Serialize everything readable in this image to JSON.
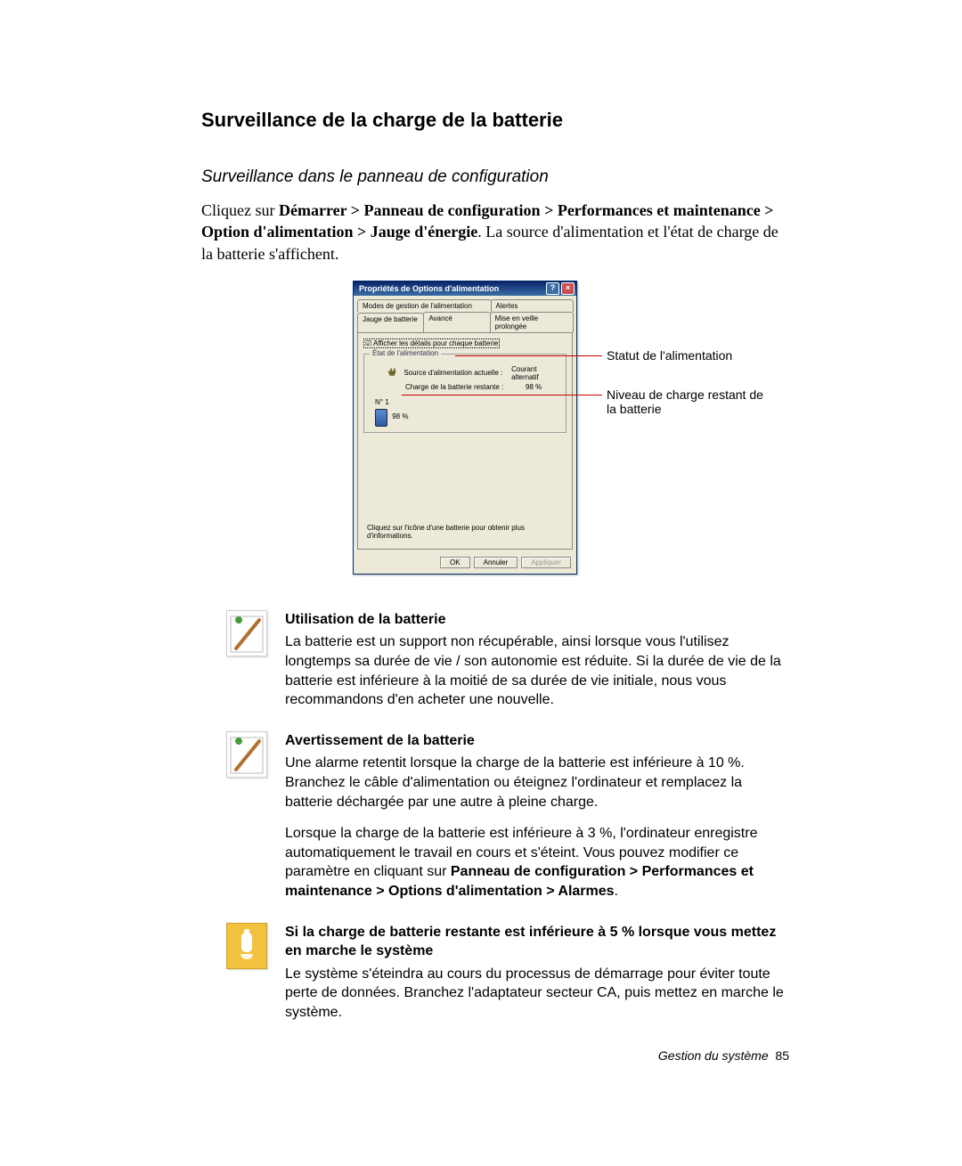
{
  "heading": "Surveillance de la charge de la batterie",
  "subheading": "Surveillance dans le panneau de configuration",
  "intro": {
    "prefix": "Cliquez sur ",
    "path": "Démarrer > Panneau de configuration > Performances et maintenance > Option d'alimentation > Jauge d'énergie",
    "suffix": ". La source d'alimentation et l'état de charge de la batterie s'affichent."
  },
  "dialog": {
    "title": "Propriétés de Options d'alimentation",
    "tabs_row1": [
      "Modes de gestion de l'alimentation",
      "Alertes"
    ],
    "tabs_row2": [
      "Jauge de batterie",
      "Avancé",
      "Mise en veille prolongée"
    ],
    "active_tab": "Jauge de batterie",
    "checkbox": "Afficher les détails pour chaque batterie",
    "fieldset_legend": "État de l'alimentation",
    "src_label": "Source d'alimentation actuelle :",
    "src_value": "Courant alternatif",
    "charge_label": "Charge de la batterie restante :",
    "charge_value": "98 %",
    "batt_num": "N° 1",
    "batt_pct": "98 %",
    "hint": "Cliquez sur l'icône d'une batterie pour obtenir plus d'informations.",
    "buttons": {
      "ok": "OK",
      "cancel": "Annuler",
      "apply": "Appliquer"
    }
  },
  "callouts": {
    "status": "Statut de l'alimentation",
    "level": "Niveau de charge restant de la batterie"
  },
  "notes": [
    {
      "title": "Utilisation de la batterie",
      "text": "La batterie est un support non récupérable, ainsi lorsque vous l'utilisez longtemps sa durée de vie / son autonomie est réduite. Si la durée de vie de la batterie est inférieure à la moitié de sa durée de vie initiale, nous vous recommandons d'en acheter une nouvelle.",
      "icon": "pen"
    },
    {
      "title": "Avertissement de la batterie",
      "text": "Une alarme retentit lorsque la charge de la batterie est inférieure à 10 %. Branchez le câble d'alimentation ou éteignez l'ordinateur et remplacez la batterie déchargée par une autre à pleine charge.",
      "icon": "pen",
      "extra_pre": "Lorsque la charge de la batterie est inférieure à 3 %, l'ordinateur enregistre automatiquement le travail en cours et s'éteint. Vous pouvez modifier ce paramètre en cliquant sur ",
      "extra_bold": "Panneau de configuration > Performances et maintenance > Options d'alimentation > Alarmes",
      "extra_post": "."
    },
    {
      "title": "Si la charge de batterie restante est inférieure à 5 % lorsque vous mettez en marche le système",
      "text": "Le système s'éteindra au cours du processus de démarrage pour éviter toute perte de données. Branchez l'adaptateur secteur CA, puis mettez en marche le système.",
      "icon": "warn"
    }
  ],
  "footer": {
    "section": "Gestion du système",
    "page": "85"
  }
}
